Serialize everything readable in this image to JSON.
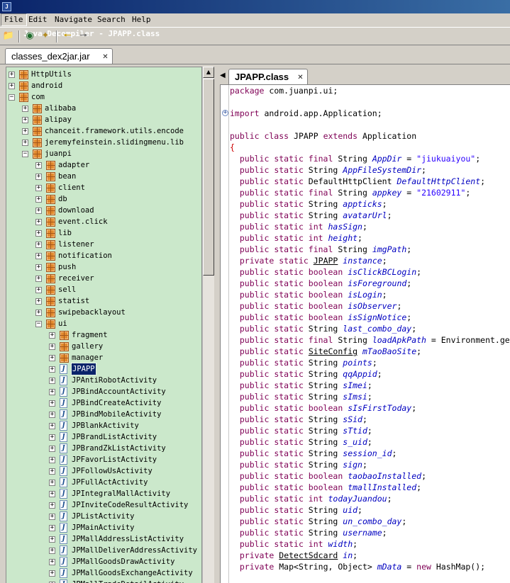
{
  "window": {
    "title": "Java Decompiler - JPAPP.class",
    "icon": "app-icon"
  },
  "menu": {
    "items": [
      "File",
      "Edit",
      "Navigate",
      "Search",
      "Help"
    ]
  },
  "toolbar": {
    "icons": [
      "open-folder-icon",
      "open-type-icon",
      "wand-icon",
      "back-arrow-icon",
      "forward-arrow-icon"
    ]
  },
  "outer_tab": {
    "label": "classes_dex2jar.jar"
  },
  "inner_tab": {
    "label": "JPAPP.class"
  },
  "tree": {
    "rows": [
      {
        "label": "HttpUtils",
        "depth": 0,
        "type": "package",
        "expanded": false
      },
      {
        "label": "android",
        "depth": 0,
        "type": "package",
        "expanded": false
      },
      {
        "label": "com",
        "depth": 0,
        "type": "package",
        "expanded": true
      },
      {
        "label": "alibaba",
        "depth": 1,
        "type": "package",
        "expanded": false
      },
      {
        "label": "alipay",
        "depth": 1,
        "type": "package",
        "expanded": false
      },
      {
        "label": "chanceit.framework.utils.encode",
        "depth": 1,
        "type": "package",
        "expanded": false
      },
      {
        "label": "jeremyfeinstein.slidingmenu.lib",
        "depth": 1,
        "type": "package",
        "expanded": false
      },
      {
        "label": "juanpi",
        "depth": 1,
        "type": "package",
        "expanded": true
      },
      {
        "label": "adapter",
        "depth": 2,
        "type": "package",
        "expanded": false
      },
      {
        "label": "bean",
        "depth": 2,
        "type": "package",
        "expanded": false
      },
      {
        "label": "client",
        "depth": 2,
        "type": "package",
        "expanded": false
      },
      {
        "label": "db",
        "depth": 2,
        "type": "package",
        "expanded": false
      },
      {
        "label": "download",
        "depth": 2,
        "type": "package",
        "expanded": false
      },
      {
        "label": "event.click",
        "depth": 2,
        "type": "package",
        "expanded": false
      },
      {
        "label": "lib",
        "depth": 2,
        "type": "package",
        "expanded": false
      },
      {
        "label": "listener",
        "depth": 2,
        "type": "package",
        "expanded": false
      },
      {
        "label": "notification",
        "depth": 2,
        "type": "package",
        "expanded": false
      },
      {
        "label": "push",
        "depth": 2,
        "type": "package",
        "expanded": false
      },
      {
        "label": "receiver",
        "depth": 2,
        "type": "package",
        "expanded": false
      },
      {
        "label": "sell",
        "depth": 2,
        "type": "package",
        "expanded": false
      },
      {
        "label": "statist",
        "depth": 2,
        "type": "package",
        "expanded": false
      },
      {
        "label": "swipebacklayout",
        "depth": 2,
        "type": "package",
        "expanded": false
      },
      {
        "label": "ui",
        "depth": 2,
        "type": "package",
        "expanded": true
      },
      {
        "label": "fragment",
        "depth": 3,
        "type": "package",
        "expanded": false
      },
      {
        "label": "gallery",
        "depth": 3,
        "type": "package",
        "expanded": false
      },
      {
        "label": "manager",
        "depth": 3,
        "type": "package",
        "expanded": false
      },
      {
        "label": "JPAPP",
        "depth": 3,
        "type": "class",
        "expanded": false,
        "selected": true
      },
      {
        "label": "JPAntiRobotActivity",
        "depth": 3,
        "type": "class",
        "expanded": false
      },
      {
        "label": "JPBindAccountActivity",
        "depth": 3,
        "type": "class",
        "expanded": false
      },
      {
        "label": "JPBindCreateActivity",
        "depth": 3,
        "type": "class",
        "expanded": false
      },
      {
        "label": "JPBindMobileActivity",
        "depth": 3,
        "type": "class",
        "expanded": false
      },
      {
        "label": "JPBlankActivity",
        "depth": 3,
        "type": "class",
        "expanded": false
      },
      {
        "label": "JPBrandListActivity",
        "depth": 3,
        "type": "class",
        "expanded": false
      },
      {
        "label": "JPBrandZkListActivity",
        "depth": 3,
        "type": "class",
        "expanded": false
      },
      {
        "label": "JPFavorListActivity",
        "depth": 3,
        "type": "class",
        "expanded": false
      },
      {
        "label": "JPFollowUsActivity",
        "depth": 3,
        "type": "class",
        "expanded": false
      },
      {
        "label": "JPFullActActivity",
        "depth": 3,
        "type": "class",
        "expanded": false
      },
      {
        "label": "JPIntegralMallActivity",
        "depth": 3,
        "type": "class",
        "expanded": false
      },
      {
        "label": "JPInviteCodeResultActivity",
        "depth": 3,
        "type": "class",
        "expanded": false
      },
      {
        "label": "JPListActivity",
        "depth": 3,
        "type": "class",
        "expanded": false
      },
      {
        "label": "JPMainActivity",
        "depth": 3,
        "type": "class",
        "expanded": false
      },
      {
        "label": "JPMallAddressListActivity",
        "depth": 3,
        "type": "class",
        "expanded": false
      },
      {
        "label": "JPMallDeliverAddressActivity",
        "depth": 3,
        "type": "class",
        "expanded": false
      },
      {
        "label": "JPMallGoodsDrawActivity",
        "depth": 3,
        "type": "class",
        "expanded": false
      },
      {
        "label": "JPMallGoodsExchangeActivity",
        "depth": 3,
        "type": "class",
        "expanded": false
      },
      {
        "label": "JPMallTradeDetailActivity",
        "depth": 3,
        "type": "class",
        "expanded": false
      }
    ]
  },
  "code": {
    "lines": [
      [
        [
          "kw",
          "package"
        ],
        [
          "t",
          " com.juanpi.ui;"
        ]
      ],
      [],
      [
        [
          "kw",
          "import"
        ],
        [
          "t",
          " android.app.Application;"
        ]
      ],
      [],
      [
        [
          "kw",
          "public class"
        ],
        [
          "t",
          " JPAPP "
        ],
        [
          "kw",
          "extends"
        ],
        [
          "t",
          " Application"
        ]
      ],
      [
        [
          "br",
          "{"
        ]
      ],
      [
        [
          "t",
          "  "
        ],
        [
          "kw",
          "public static final"
        ],
        [
          "t",
          " String "
        ],
        [
          "f",
          "AppDir"
        ],
        [
          "t",
          " = "
        ],
        [
          "s",
          "\"jiukuaiyou\""
        ],
        [
          "t",
          ";"
        ]
      ],
      [
        [
          "t",
          "  "
        ],
        [
          "kw",
          "public static"
        ],
        [
          "t",
          " String "
        ],
        [
          "f",
          "AppFileSystemDir"
        ],
        [
          "t",
          ";"
        ]
      ],
      [
        [
          "t",
          "  "
        ],
        [
          "kw",
          "public static"
        ],
        [
          "t",
          " DefaultHttpClient "
        ],
        [
          "f",
          "DefaultHttpClient"
        ],
        [
          "t",
          ";"
        ]
      ],
      [
        [
          "t",
          "  "
        ],
        [
          "kw",
          "public static final"
        ],
        [
          "t",
          " String "
        ],
        [
          "f",
          "appkey"
        ],
        [
          "t",
          " = "
        ],
        [
          "s",
          "\"21602911\""
        ],
        [
          "t",
          ";"
        ]
      ],
      [
        [
          "t",
          "  "
        ],
        [
          "kw",
          "public static"
        ],
        [
          "t",
          " String "
        ],
        [
          "f",
          "appticks"
        ],
        [
          "t",
          ";"
        ]
      ],
      [
        [
          "t",
          "  "
        ],
        [
          "kw",
          "public static"
        ],
        [
          "t",
          " String "
        ],
        [
          "f",
          "avatarUrl"
        ],
        [
          "t",
          ";"
        ]
      ],
      [
        [
          "t",
          "  "
        ],
        [
          "kw",
          "public static int"
        ],
        [
          "t",
          " "
        ],
        [
          "f",
          "hasSign"
        ],
        [
          "t",
          ";"
        ]
      ],
      [
        [
          "t",
          "  "
        ],
        [
          "kw",
          "public static int"
        ],
        [
          "t",
          " "
        ],
        [
          "f",
          "height"
        ],
        [
          "t",
          ";"
        ]
      ],
      [
        [
          "t",
          "  "
        ],
        [
          "kw",
          "public static final"
        ],
        [
          "t",
          " String "
        ],
        [
          "f",
          "imgPath"
        ],
        [
          "t",
          ";"
        ]
      ],
      [
        [
          "t",
          "  "
        ],
        [
          "kw",
          "private static"
        ],
        [
          "t",
          " "
        ],
        [
          "u",
          "JPAPP"
        ],
        [
          "t",
          " "
        ],
        [
          "f",
          "instance"
        ],
        [
          "t",
          ";"
        ]
      ],
      [
        [
          "t",
          "  "
        ],
        [
          "kw",
          "public static boolean"
        ],
        [
          "t",
          " "
        ],
        [
          "f",
          "isClickBCLogin"
        ],
        [
          "t",
          ";"
        ]
      ],
      [
        [
          "t",
          "  "
        ],
        [
          "kw",
          "public static boolean"
        ],
        [
          "t",
          " "
        ],
        [
          "f",
          "isForeground"
        ],
        [
          "t",
          ";"
        ]
      ],
      [
        [
          "t",
          "  "
        ],
        [
          "kw",
          "public static boolean"
        ],
        [
          "t",
          " "
        ],
        [
          "f",
          "isLogin"
        ],
        [
          "t",
          ";"
        ]
      ],
      [
        [
          "t",
          "  "
        ],
        [
          "kw",
          "public static boolean"
        ],
        [
          "t",
          " "
        ],
        [
          "f",
          "isObserver"
        ],
        [
          "t",
          ";"
        ]
      ],
      [
        [
          "t",
          "  "
        ],
        [
          "kw",
          "public static boolean"
        ],
        [
          "t",
          " "
        ],
        [
          "f",
          "isSignNotice"
        ],
        [
          "t",
          ";"
        ]
      ],
      [
        [
          "t",
          "  "
        ],
        [
          "kw",
          "public static"
        ],
        [
          "t",
          " String "
        ],
        [
          "f",
          "last_combo_day"
        ],
        [
          "t",
          ";"
        ]
      ],
      [
        [
          "t",
          "  "
        ],
        [
          "kw",
          "public static final"
        ],
        [
          "t",
          " String "
        ],
        [
          "f",
          "loadApkPath"
        ],
        [
          "t",
          " = Environment.ge"
        ]
      ],
      [
        [
          "t",
          "  "
        ],
        [
          "kw",
          "public static"
        ],
        [
          "t",
          " "
        ],
        [
          "u",
          "SiteConfig"
        ],
        [
          "t",
          " "
        ],
        [
          "f",
          "mTaoBaoSite"
        ],
        [
          "t",
          ";"
        ]
      ],
      [
        [
          "t",
          "  "
        ],
        [
          "kw",
          "public static"
        ],
        [
          "t",
          " String "
        ],
        [
          "f",
          "points"
        ],
        [
          "t",
          ";"
        ]
      ],
      [
        [
          "t",
          "  "
        ],
        [
          "kw",
          "public static"
        ],
        [
          "t",
          " String "
        ],
        [
          "f",
          "qqAppid"
        ],
        [
          "t",
          ";"
        ]
      ],
      [
        [
          "t",
          "  "
        ],
        [
          "kw",
          "public static"
        ],
        [
          "t",
          " String "
        ],
        [
          "f",
          "sImei"
        ],
        [
          "t",
          ";"
        ]
      ],
      [
        [
          "t",
          "  "
        ],
        [
          "kw",
          "public static"
        ],
        [
          "t",
          " String "
        ],
        [
          "f",
          "sImsi"
        ],
        [
          "t",
          ";"
        ]
      ],
      [
        [
          "t",
          "  "
        ],
        [
          "kw",
          "public static boolean"
        ],
        [
          "t",
          " "
        ],
        [
          "f",
          "sIsFirstToday"
        ],
        [
          "t",
          ";"
        ]
      ],
      [
        [
          "t",
          "  "
        ],
        [
          "kw",
          "public static"
        ],
        [
          "t",
          " String "
        ],
        [
          "f",
          "sSid"
        ],
        [
          "t",
          ";"
        ]
      ],
      [
        [
          "t",
          "  "
        ],
        [
          "kw",
          "public static"
        ],
        [
          "t",
          " String "
        ],
        [
          "f",
          "sTtid"
        ],
        [
          "t",
          ";"
        ]
      ],
      [
        [
          "t",
          "  "
        ],
        [
          "kw",
          "public static"
        ],
        [
          "t",
          " String "
        ],
        [
          "f",
          "s_uid"
        ],
        [
          "t",
          ";"
        ]
      ],
      [
        [
          "t",
          "  "
        ],
        [
          "kw",
          "public static"
        ],
        [
          "t",
          " String "
        ],
        [
          "f",
          "session_id"
        ],
        [
          "t",
          ";"
        ]
      ],
      [
        [
          "t",
          "  "
        ],
        [
          "kw",
          "public static"
        ],
        [
          "t",
          " String "
        ],
        [
          "f",
          "sign"
        ],
        [
          "t",
          ";"
        ]
      ],
      [
        [
          "t",
          "  "
        ],
        [
          "kw",
          "public static boolean"
        ],
        [
          "t",
          " "
        ],
        [
          "f",
          "taobaoInstalled"
        ],
        [
          "t",
          ";"
        ]
      ],
      [
        [
          "t",
          "  "
        ],
        [
          "kw",
          "public static boolean"
        ],
        [
          "t",
          " "
        ],
        [
          "f",
          "tmallInstalled"
        ],
        [
          "t",
          ";"
        ]
      ],
      [
        [
          "t",
          "  "
        ],
        [
          "kw",
          "public static int"
        ],
        [
          "t",
          " "
        ],
        [
          "f",
          "todayJuandou"
        ],
        [
          "t",
          ";"
        ]
      ],
      [
        [
          "t",
          "  "
        ],
        [
          "kw",
          "public static"
        ],
        [
          "t",
          " String "
        ],
        [
          "f",
          "uid"
        ],
        [
          "t",
          ";"
        ]
      ],
      [
        [
          "t",
          "  "
        ],
        [
          "kw",
          "public static"
        ],
        [
          "t",
          " String "
        ],
        [
          "f",
          "un_combo_day"
        ],
        [
          "t",
          ";"
        ]
      ],
      [
        [
          "t",
          "  "
        ],
        [
          "kw",
          "public static"
        ],
        [
          "t",
          " String "
        ],
        [
          "f",
          "username"
        ],
        [
          "t",
          ";"
        ]
      ],
      [
        [
          "t",
          "  "
        ],
        [
          "kw",
          "public static int"
        ],
        [
          "t",
          " "
        ],
        [
          "f",
          "width"
        ],
        [
          "t",
          ";"
        ]
      ],
      [
        [
          "t",
          "  "
        ],
        [
          "kw",
          "private"
        ],
        [
          "t",
          " "
        ],
        [
          "u",
          "DetectSdcard"
        ],
        [
          "t",
          " "
        ],
        [
          "f",
          "in"
        ],
        [
          "t",
          ";"
        ]
      ],
      [
        [
          "t",
          "  "
        ],
        [
          "kw",
          "private"
        ],
        [
          "t",
          " Map<String, Object> "
        ],
        [
          "f",
          "mData"
        ],
        [
          "t",
          " = "
        ],
        [
          "kw",
          "new"
        ],
        [
          "t",
          " HashMap();"
        ]
      ]
    ],
    "fold_markers": [
      {
        "line": 2,
        "symbol": "+"
      }
    ]
  }
}
